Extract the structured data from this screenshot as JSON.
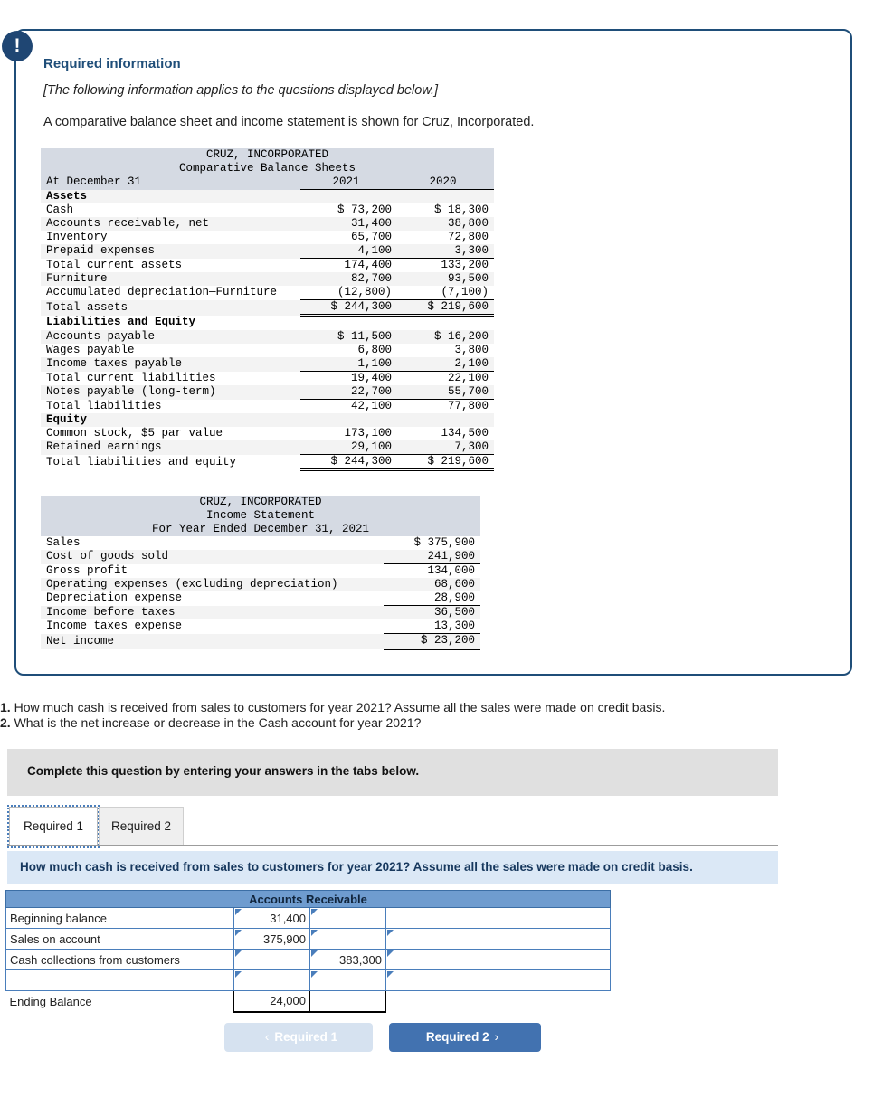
{
  "card": {
    "alert_icon": "exclamation-icon",
    "title": "Required information",
    "italic_note": "[The following information applies to the questions displayed below.]",
    "lead": "A comparative balance sheet and income statement is shown for Cruz, Incorporated."
  },
  "balance_sheet": {
    "company": "CRUZ, INCORPORATED",
    "statement": "Comparative Balance Sheets",
    "row_label_header": "At December 31",
    "col_2021": "2021",
    "col_2020": "2020",
    "rows": [
      {
        "label": "Assets",
        "v2021": "",
        "v2020": "",
        "bold": true
      },
      {
        "label": "Cash",
        "v2021": "$ 73,200",
        "v2020": "$ 18,300"
      },
      {
        "label": "Accounts receivable, net",
        "v2021": "31,400",
        "v2020": "38,800"
      },
      {
        "label": "Inventory",
        "v2021": "65,700",
        "v2020": "72,800"
      },
      {
        "label": "Prepaid expenses",
        "v2021": "4,100",
        "v2020": "3,300"
      },
      {
        "label": "Total current assets",
        "v2021": "174,400",
        "v2020": "133,200"
      },
      {
        "label": "Furniture",
        "v2021": "82,700",
        "v2020": "93,500"
      },
      {
        "label": "Accumulated depreciation—Furniture",
        "v2021": "(12,800)",
        "v2020": "(7,100)"
      },
      {
        "label": "Total assets",
        "v2021": "$ 244,300",
        "v2020": "$ 219,600"
      },
      {
        "label": "Liabilities and Equity",
        "v2021": "",
        "v2020": "",
        "bold": true
      },
      {
        "label": "Accounts payable",
        "v2021": "$ 11,500",
        "v2020": "$ 16,200"
      },
      {
        "label": "Wages payable",
        "v2021": "6,800",
        "v2020": "3,800"
      },
      {
        "label": "Income taxes payable",
        "v2021": "1,100",
        "v2020": "2,100"
      },
      {
        "label": "Total current liabilities",
        "v2021": "19,400",
        "v2020": "22,100"
      },
      {
        "label": "Notes payable (long-term)",
        "v2021": "22,700",
        "v2020": "55,700"
      },
      {
        "label": "Total liabilities",
        "v2021": "42,100",
        "v2020": "77,800"
      },
      {
        "label": "Equity",
        "v2021": "",
        "v2020": "",
        "bold": true
      },
      {
        "label": "Common stock, $5 par value",
        "v2021": "173,100",
        "v2020": "134,500"
      },
      {
        "label": "Retained earnings",
        "v2021": "29,100",
        "v2020": "7,300"
      },
      {
        "label": "Total liabilities and equity",
        "v2021": "$ 244,300",
        "v2020": "$ 219,600"
      }
    ]
  },
  "income_statement": {
    "company": "CRUZ, INCORPORATED",
    "statement": "Income Statement",
    "period": "For Year Ended December 31, 2021",
    "rows": [
      {
        "label": "Sales",
        "value": "$ 375,900"
      },
      {
        "label": "Cost of goods sold",
        "value": "241,900"
      },
      {
        "label": "Gross profit",
        "value": "134,000"
      },
      {
        "label": "Operating expenses (excluding depreciation)",
        "value": "68,600"
      },
      {
        "label": "Depreciation expense",
        "value": "28,900"
      },
      {
        "label": "Income before taxes",
        "value": "36,500"
      },
      {
        "label": "Income taxes expense",
        "value": "13,300"
      },
      {
        "label": "Net income",
        "value": "$ 23,200"
      }
    ]
  },
  "questions": {
    "q1_num": "1.",
    "q1_text": "How much cash is received from sales to customers for year 2021? Assume all the sales were made on credit basis.",
    "q2_num": "2.",
    "q2_text": "What is the net increase or decrease in the Cash account for year 2021?"
  },
  "instruction_bar": {
    "text": "Complete this question by entering your answers in the tabs below."
  },
  "tabs": {
    "active": "Required 1",
    "inactive": "Required 2"
  },
  "prompt_band": {
    "text": "How much cash is received from sales to customers for year 2021? Assume all the sales were made on credit basis."
  },
  "ar_table": {
    "header": "Accounts Receivable",
    "rows": [
      {
        "label": "Beginning balance",
        "debit": "31,400",
        "credit": ""
      },
      {
        "label": "Sales on account",
        "debit": "375,900",
        "credit": ""
      },
      {
        "label": "Cash collections from customers",
        "debit": "",
        "credit": "383,300"
      },
      {
        "label": "",
        "debit": "",
        "credit": ""
      }
    ],
    "ending": {
      "label": "Ending Balance",
      "debit": "24,000",
      "credit": ""
    }
  },
  "nav": {
    "prev_label": "Required 1",
    "prev_chevron": "‹",
    "next_label": "Required 2",
    "next_chevron": "›"
  },
  "colors": {
    "card_border": "#1f4e79",
    "badge": "#1f4673",
    "accent_blue": "#4272b0",
    "table_header_blue": "#6f9ccf",
    "prompt_band": "#dbe8f6",
    "gray_band": "#e0e0e0"
  }
}
